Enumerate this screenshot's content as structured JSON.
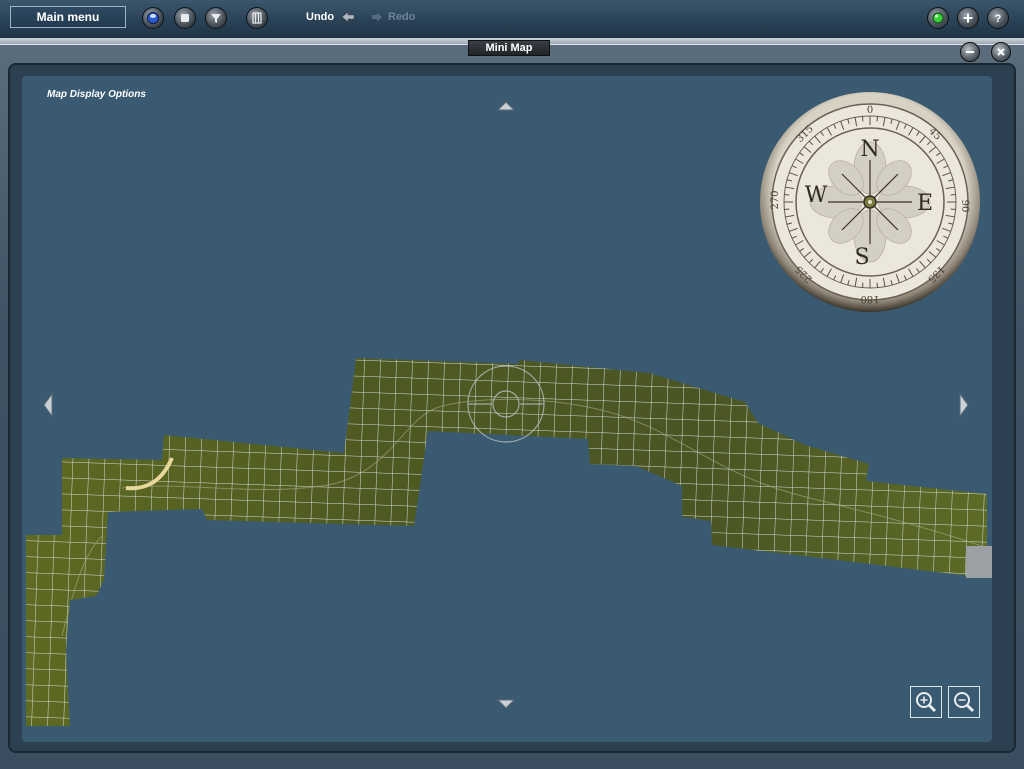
{
  "toolbar": {
    "main_menu_label": "Main menu",
    "undo_label": "Undo",
    "redo_label": "Redo",
    "tool_icons": [
      "globe-icon",
      "stop-icon",
      "filter-icon",
      "grid-icon"
    ],
    "right_icons": [
      "status-light-icon",
      "plus-icon",
      "help-icon"
    ]
  },
  "window": {
    "title": "Mini Map",
    "controls": [
      "minimize-icon",
      "close-icon"
    ]
  },
  "map": {
    "display_options_label": "Map Display Options",
    "compass": {
      "cardinals": [
        "N",
        "E",
        "S",
        "W"
      ],
      "degrees": [
        "0",
        "45",
        "90",
        "135",
        "180",
        "225",
        "270",
        "315"
      ]
    },
    "zoom_controls": [
      "zoom-in-icon",
      "zoom-out-icon"
    ]
  },
  "colors": {
    "water": "#3a5a72",
    "terrain": "#4d5a1f",
    "grid": "#d8dde0",
    "status_light": "#3bd13b"
  }
}
